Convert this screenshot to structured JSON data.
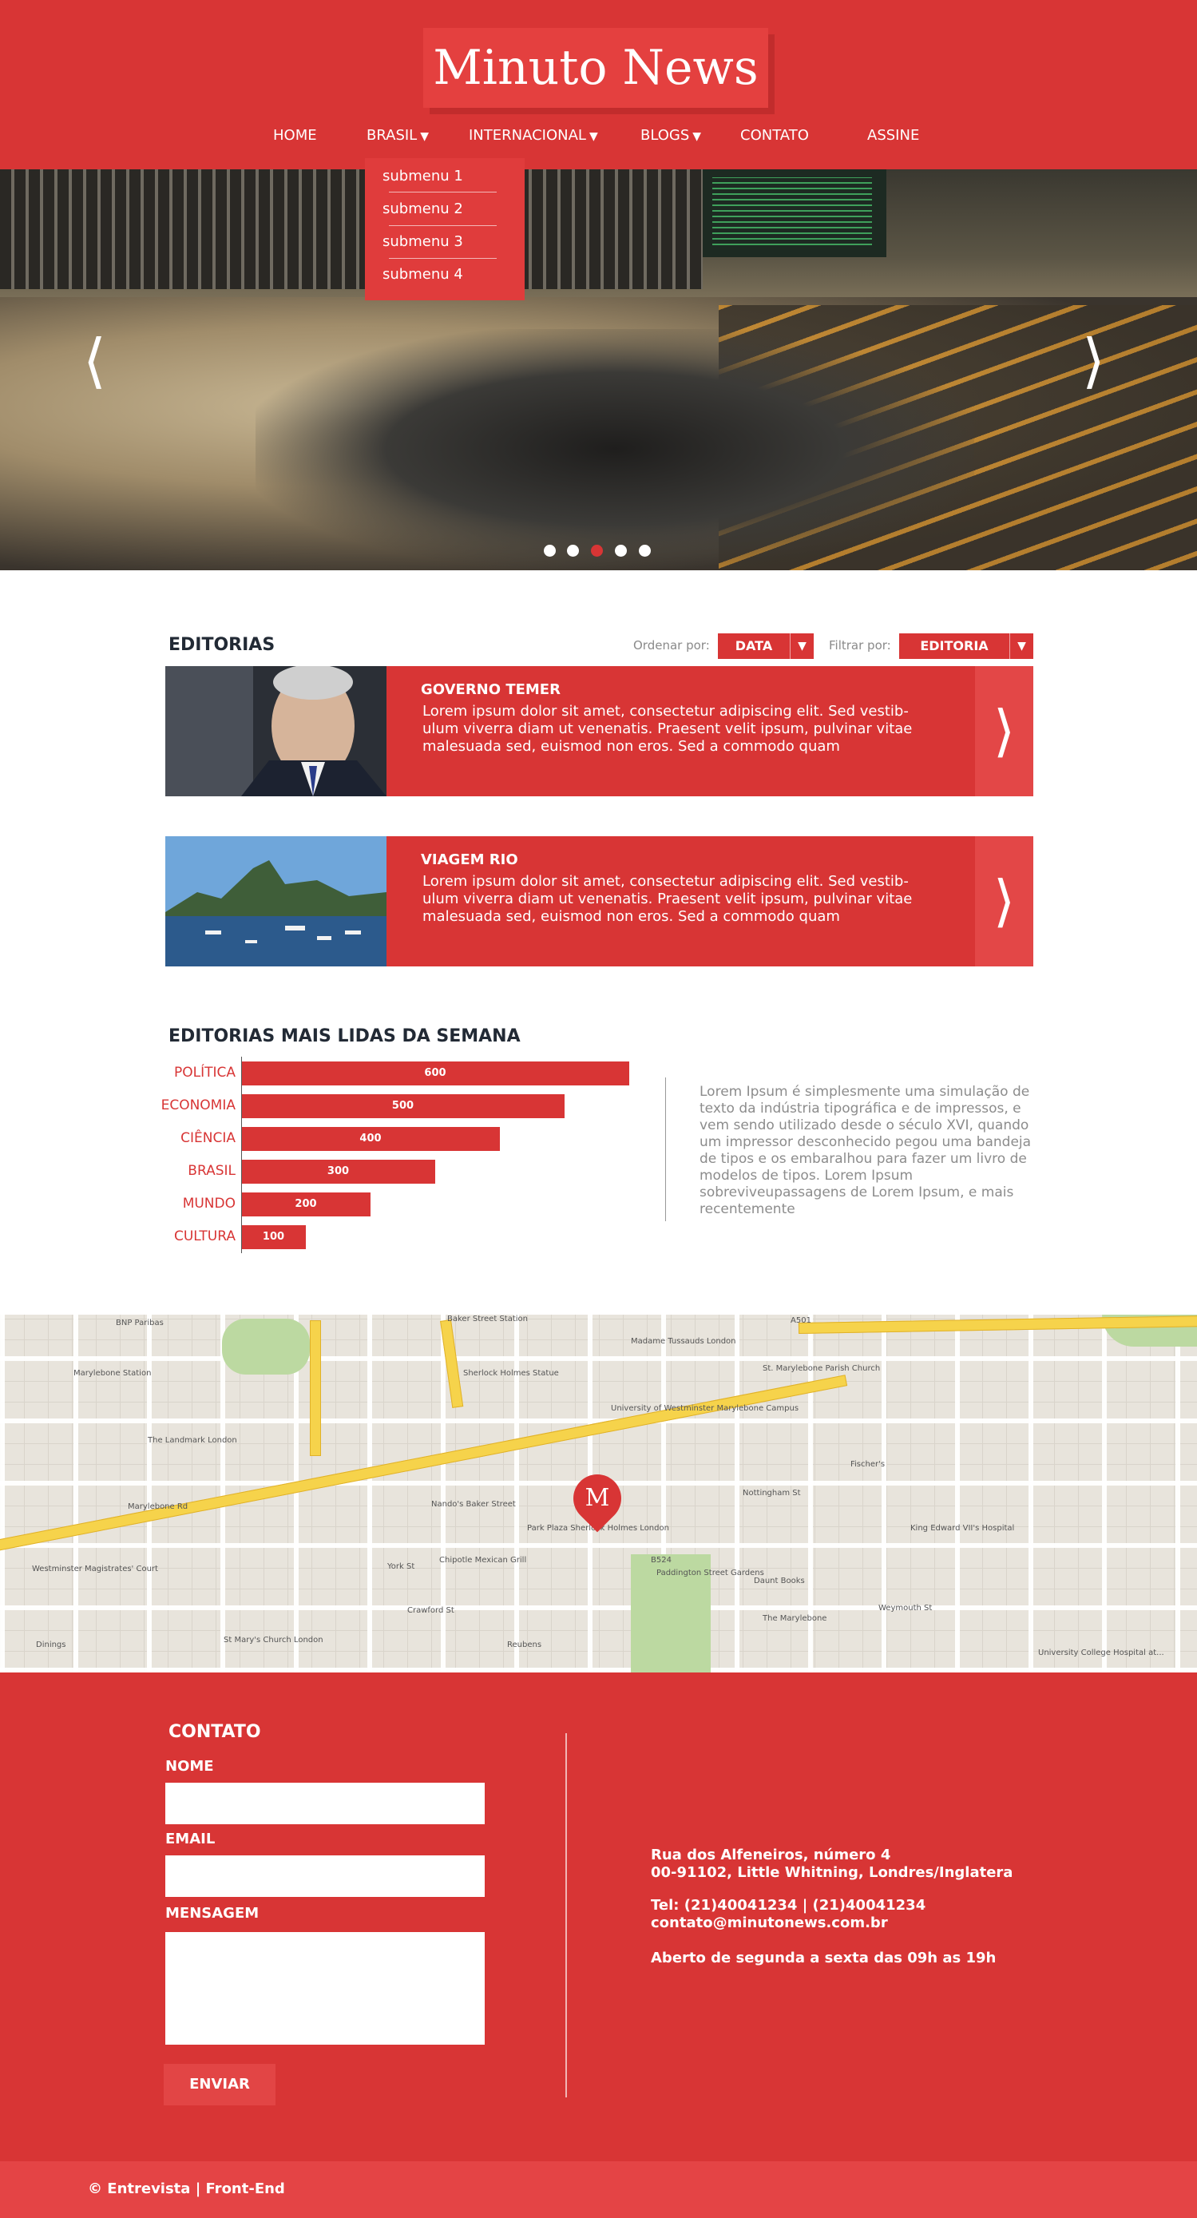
{
  "header": {
    "logo": "Minuto News",
    "nav": [
      {
        "label": "HOME",
        "arrow": ""
      },
      {
        "label": "BRASIL",
        "arrow": "▼"
      },
      {
        "label": "INTERNACIONAL",
        "arrow": "▼"
      },
      {
        "label": "BLOGS",
        "arrow": "▼"
      },
      {
        "label": "CONTATO",
        "arrow": ""
      },
      {
        "label": "ASSINE",
        "arrow": ""
      }
    ],
    "submenu": [
      "submenu 1",
      "submenu 2",
      "submenu 3",
      "submenu 4"
    ]
  },
  "hero": {
    "prev": "⟨",
    "next": "⟩",
    "slides": 5,
    "active_slide": 3
  },
  "editorias": {
    "title": "EDITORIAS",
    "order_label": "Ordenar por:",
    "order_value": "DATA",
    "filter_label": "Filtrar por:",
    "filter_value": "EDITORIA",
    "dropdown_arrow": "▼",
    "cards": [
      {
        "title": "GOVERNO TEMER",
        "text": "Lorem ipsum dolor sit amet, consectetur adipiscing elit. Sed vestib-ulum viverra diam ut venenatis. Praesent velit ipsum, pulvinar vitae malesuada sed, euismod non eros. Sed a commodo quam",
        "go": "⟩"
      },
      {
        "title": "VIAGEM RIO",
        "text": "Lorem ipsum dolor sit amet, consectetur adipiscing elit. Sed vestib-ulum viverra diam ut venenatis. Praesent velit ipsum, pulvinar vitae malesuada sed, euismod non eros. Sed a commodo quam",
        "go": "⟩"
      }
    ]
  },
  "chart_data": {
    "type": "bar",
    "title": "EDITORIAS MAIS LIDAS DA SEMANA",
    "orientation": "horizontal",
    "categories": [
      "POLÍTICA",
      "ECONOMIA",
      "CIÊNCIA",
      "BRASIL",
      "MUNDO",
      "CULTURA"
    ],
    "values": [
      600,
      500,
      400,
      300,
      200,
      100
    ],
    "xlim": [
      0,
      600
    ],
    "bar_color": "#d83535",
    "data_labels": true
  },
  "side_text": "Lorem Ipsum é simplesmente uma simulação de texto da indústria tipográfica e de impressos, e vem sendo utilizado desde o século XVI, quando um impressor desconhecido pegou uma bandeja de tipos e os embaralhou para fazer um livro de modelos de tipos. Lorem Ipsum sobreviveupassagens de Lorem Ipsum, e mais recentemente",
  "map": {
    "marker": "M",
    "labels": [
      "Baker Street Station",
      "Madame Tussauds London",
      "Marylebone Station",
      "Sherlock Holmes Statue",
      "The Landmark London",
      "University of Westminster Marylebone Campus",
      "St. Marylebone Parish Church",
      "Nottingham St",
      "Marylebone Rd",
      "Park Plaza Sherlock Holmes London",
      "Paddington Street Gardens",
      "Daunt Books",
      "The Marylebone",
      "Weymouth St",
      "Crawford St",
      "York St",
      "St Mary's Church London",
      "Westminster Magistrates' Court",
      "King Edward VII's Hospital",
      "Chipotle Mexican Grill",
      "Nando's Baker Street",
      "Reubens",
      "Dinings",
      "Fischer's",
      "University College Hospital at...",
      "BNP Paribas",
      "A501",
      "B524"
    ]
  },
  "contact": {
    "title": "CONTATO",
    "name_label": "NOME",
    "email_label": "EMAIL",
    "message_label": "MENSAGEM",
    "send_label": "ENVIAR",
    "address1": "Rua dos Alfeneiros, número 4",
    "address2": "00-91102, Little Whitning, Londres/Inglatera",
    "phone": "Tel: (21)40041234 | (21)40041234",
    "email": "contato@minutonews.com.br",
    "hours": "Aberto de segunda a sexta das 09h as 19h"
  },
  "footer": {
    "text": "©  Entrevista | Front-End"
  },
  "colors": {
    "accent": "#d83535",
    "accent_light": "#e34747",
    "title_dark": "#222a35"
  }
}
